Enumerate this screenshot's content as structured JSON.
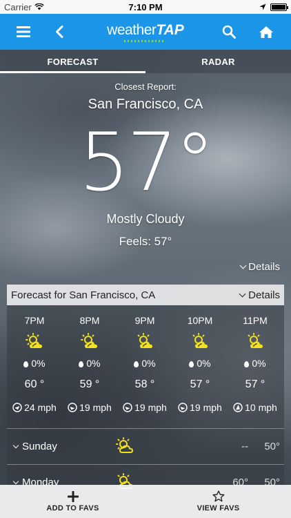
{
  "status_bar": {
    "carrier": "Carrier",
    "time": "7:10 PM"
  },
  "nav": {
    "logo_a": "weather",
    "logo_b": "TAP"
  },
  "tabs": [
    {
      "label": "FORECAST",
      "active": true
    },
    {
      "label": "RADAR",
      "active": false
    }
  ],
  "current": {
    "closest_label": "Closest Report:",
    "location": "San Francisco, CA",
    "temperature": "57°",
    "condition": "Mostly Cloudy",
    "feels_like": "Feels: 57°",
    "details_label": "Details"
  },
  "forecast_panel": {
    "title": "Forecast for San Francisco, CA",
    "details_label": "Details",
    "hours": [
      {
        "time": "7PM",
        "icon": "partly-cloudy-sun-icon",
        "precip": "0%",
        "temp": "60 °",
        "wind": "24 mph"
      },
      {
        "time": "8PM",
        "icon": "partly-cloudy-sun-icon",
        "precip": "0%",
        "temp": "59 °",
        "wind": "19 mph"
      },
      {
        "time": "9PM",
        "icon": "partly-cloudy-sun-icon",
        "precip": "0%",
        "temp": "58 °",
        "wind": "19 mph"
      },
      {
        "time": "10PM",
        "icon": "partly-cloudy-sun-icon",
        "precip": "0%",
        "temp": "57 °",
        "wind": "19 mph"
      },
      {
        "time": "11PM",
        "icon": "partly-cloudy-sun-icon",
        "precip": "0%",
        "temp": "57 °",
        "wind": "10 mph"
      }
    ],
    "days": [
      {
        "name": "Sunday",
        "icon": "partly-cloudy-sun-icon",
        "high": "--",
        "low": "50°"
      },
      {
        "name": "Monday",
        "icon": "partly-cloudy-sun-icon",
        "high": "60°",
        "low": "50°"
      }
    ]
  },
  "bottom_bar": {
    "add_favs": "ADD TO FAVS",
    "view_favs": "VIEW FAVS"
  },
  "colors": {
    "nav_blue": "#1b95e8",
    "icon_yellow": "#f2e11b"
  }
}
